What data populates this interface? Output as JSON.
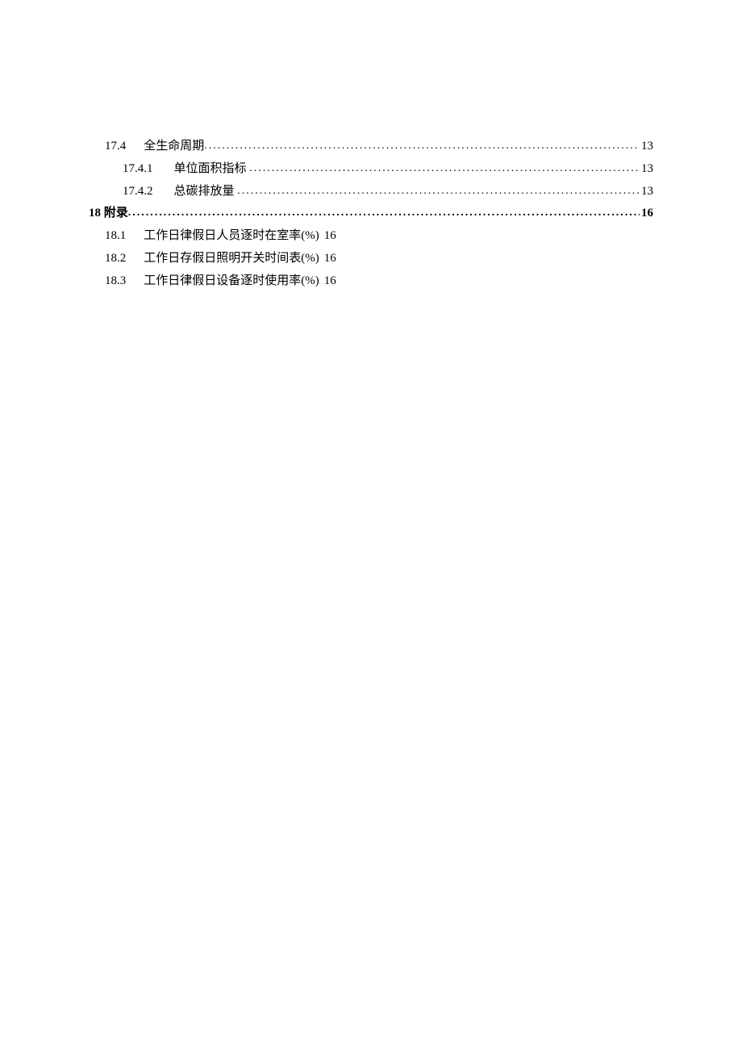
{
  "leader": "...................................................................................................................................................",
  "entries": {
    "e1": {
      "num": "17.4",
      "title": "全生命周期",
      "page": "13"
    },
    "e2": {
      "num": "17.4.1",
      "title": "单位面积指标",
      "page": "13"
    },
    "e3": {
      "num": "17.4.2",
      "title": "总碳排放量",
      "page": "13"
    },
    "e4": {
      "num": "18",
      "title": "附录",
      "page": "16"
    },
    "e5": {
      "num": "18.1",
      "title": "工作日律假日人员逐时在室率(%)",
      "page": "16"
    },
    "e6": {
      "num": "18.2",
      "title": "工作日存假日照明开关时间表(%)",
      "page": "16"
    },
    "e7": {
      "num": "18.3",
      "title": "工作日律假日设备逐时使用率(%)",
      "page": "16"
    }
  }
}
